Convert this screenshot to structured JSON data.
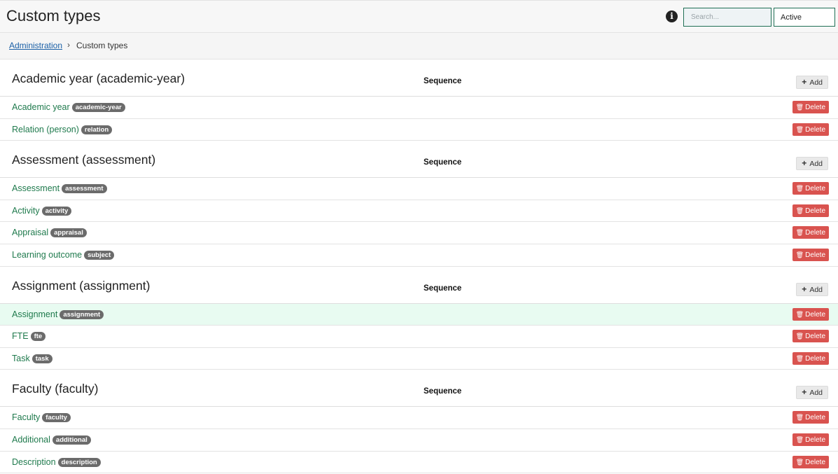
{
  "header": {
    "title": "Custom types",
    "search_placeholder": "Search...",
    "status_value": "Active"
  },
  "breadcrumb": {
    "parent": "Administration",
    "separator": "›",
    "current": "Custom types"
  },
  "labels": {
    "sequence": "Sequence",
    "add": "Add",
    "delete": "Delete"
  },
  "sections": [
    {
      "title": "Academic year (academic-year)",
      "rows": [
        {
          "label": "Academic year",
          "tag": "academic-year"
        },
        {
          "label": "Relation (person)",
          "tag": "relation"
        }
      ]
    },
    {
      "title": "Assessment (assessment)",
      "rows": [
        {
          "label": "Assessment",
          "tag": "assessment"
        },
        {
          "label": "Activity",
          "tag": "activity"
        },
        {
          "label": "Appraisal",
          "tag": "appraisal"
        },
        {
          "label": "Learning outcome",
          "tag": "subject"
        }
      ]
    },
    {
      "title": "Assignment (assignment)",
      "rows": [
        {
          "label": "Assignment",
          "tag": "assignment",
          "highlight": true
        },
        {
          "label": "FTE",
          "tag": "fte"
        },
        {
          "label": "Task",
          "tag": "task"
        }
      ]
    },
    {
      "title": "Faculty (faculty)",
      "rows": [
        {
          "label": "Faculty",
          "tag": "faculty"
        },
        {
          "label": "Additional",
          "tag": "additional"
        },
        {
          "label": "Description",
          "tag": "description"
        }
      ]
    }
  ],
  "colors": {
    "accent_green": "#1f7a4d",
    "delete_red": "#d9534f",
    "link_blue": "#1a5fa6",
    "highlight_row": "#e8fbf1"
  },
  "icons": {
    "info": "info-circle-icon",
    "add": "plus-icon",
    "delete": "trash-icon"
  }
}
